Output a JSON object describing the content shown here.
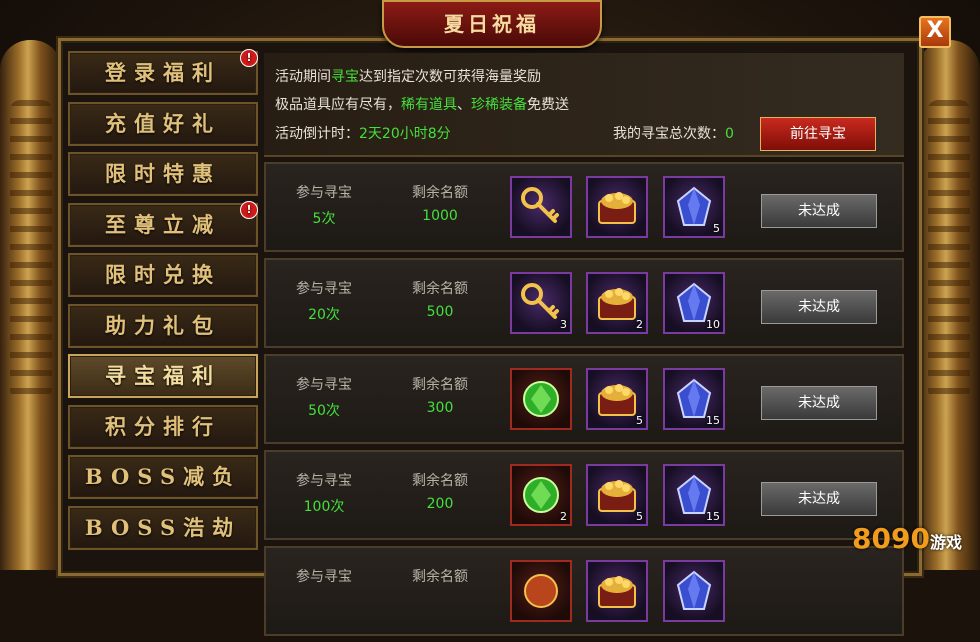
{
  "title": "夏日祝福",
  "close_label": "X",
  "menu": [
    {
      "label": "登录福利",
      "badge": "!"
    },
    {
      "label": "充值好礼"
    },
    {
      "label": "限时特惠"
    },
    {
      "label": "至尊立减",
      "badge": "!"
    },
    {
      "label": "限时兑换"
    },
    {
      "label": "助力礼包"
    },
    {
      "label": "寻宝福利",
      "active": true
    },
    {
      "label": "积分排行"
    },
    {
      "label": "BOSS减负"
    },
    {
      "label": "BOSS浩劫"
    }
  ],
  "info": {
    "line1_a": "活动期间",
    "line1_b": "寻宝",
    "line1_c": "达到指定次数可获得海量奖励",
    "line2_a": "极品道具应有尽有，",
    "line2_b": "稀有道具",
    "line2_c": "、",
    "line2_d": "珍稀装备",
    "line2_e": "免费送",
    "countdown_label": "活动倒计时：",
    "countdown_value": "2天20小时8分",
    "total_label": "我的寻宝总次数：",
    "total_value": "0",
    "goto_label": "前往寻宝"
  },
  "row_labels": {
    "participate": "参与寻宝",
    "remaining": "剩余名额"
  },
  "rows": [
    {
      "count": "5次",
      "remaining": "1000",
      "items": [
        {
          "icon": "key-icon",
          "qty": ""
        },
        {
          "icon": "treasure-chest-icon",
          "qty": ""
        },
        {
          "icon": "blue-crystal-icon",
          "qty": "5"
        }
      ],
      "status": "未达成"
    },
    {
      "count": "20次",
      "remaining": "500",
      "items": [
        {
          "icon": "key-icon",
          "qty": "3"
        },
        {
          "icon": "treasure-chest-icon",
          "qty": "2"
        },
        {
          "icon": "blue-crystal-icon",
          "qty": "10"
        }
      ],
      "status": "未达成"
    },
    {
      "count": "50次",
      "remaining": "300",
      "items": [
        {
          "icon": "green-gem-icon",
          "qty": ""
        },
        {
          "icon": "treasure-chest-icon",
          "qty": "5"
        },
        {
          "icon": "blue-crystal-icon",
          "qty": "15"
        }
      ],
      "status": "未达成"
    },
    {
      "count": "100次",
      "remaining": "200",
      "items": [
        {
          "icon": "green-gem-icon",
          "qty": "2"
        },
        {
          "icon": "treasure-chest-icon",
          "qty": "5"
        },
        {
          "icon": "blue-crystal-icon",
          "qty": "15"
        }
      ],
      "status": "未达成"
    },
    {
      "count": "",
      "remaining": "",
      "items": [
        {
          "icon": "red-item-icon",
          "qty": ""
        },
        {
          "icon": "treasure-chest-icon",
          "qty": ""
        },
        {
          "icon": "blue-crystal-icon",
          "qty": ""
        }
      ],
      "status": ""
    }
  ],
  "watermark": {
    "brand": "8090",
    "suffix": "游戏"
  },
  "colors": {
    "accent_green": "#44e03a",
    "button_red": "#c92a1e",
    "gold": "#e0c07a"
  }
}
